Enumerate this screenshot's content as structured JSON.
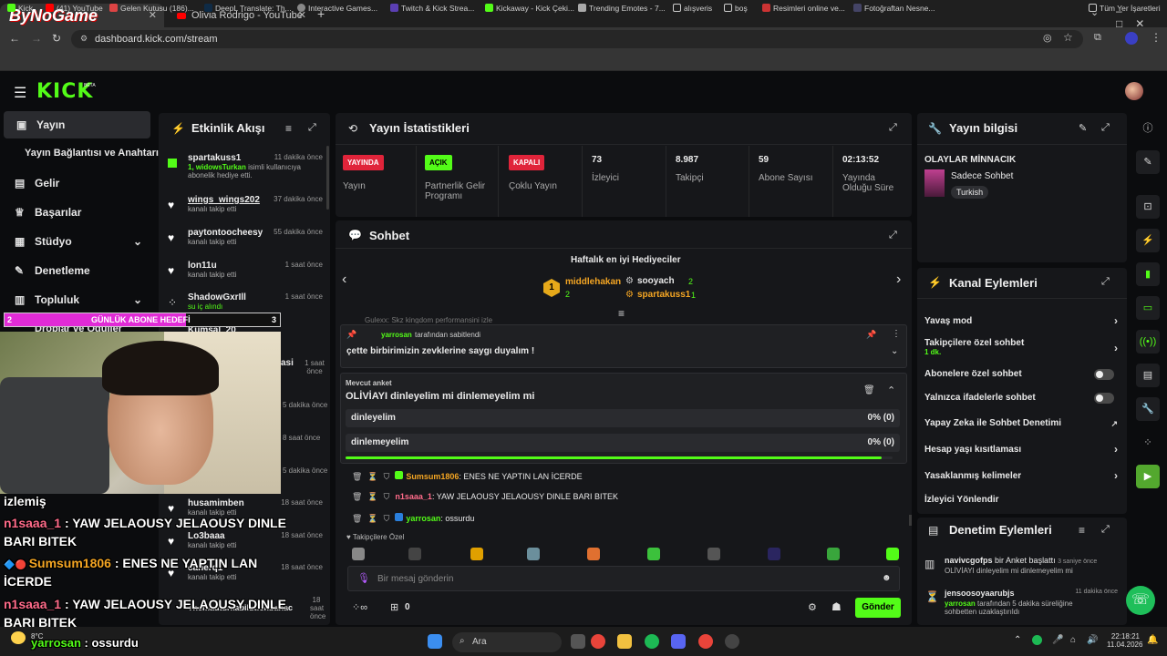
{
  "browser": {
    "tab1_title": "ByNoGame",
    "tab2_title": "Olivia Rodrigo - YouTube",
    "url": "dashboard.kick.com/stream",
    "bookmarks": [
      "Kick",
      "(41) YouTube",
      "Gelen Kutusu (186)...",
      "DeepL Translate: Th...",
      "Interactive Games...",
      "Twitch & Kick Strea...",
      "Kickaway - Kick Çeki...",
      "Trending Emotes - 7...",
      "alışveris",
      "boş",
      "Resimleri online ve...",
      "Fotoğraftan Nesne..."
    ],
    "bookmarks_right": "Tüm Yer İşaretleri"
  },
  "kick": {
    "logo": "KICK",
    "beta": "BETA"
  },
  "sidebar": {
    "items": [
      "Yayın",
      "Yayın Bağlantısı ve Anahtarı",
      "Gelir",
      "Başarılar",
      "Stüdyo",
      "Denetleme",
      "Topluluk",
      "Droplar ve Ödüller"
    ]
  },
  "activity": {
    "title": "Etkinlik Akışı",
    "items": [
      {
        "name": "spartakuss1",
        "time": "11 dakika önce",
        "text1": "1, widowsTurkan",
        "text2": "isimli kullanıcıya abonelik hediye etti."
      },
      {
        "name": "wings_wings202",
        "time": "37 dakika önce",
        "text": "kanalı takip etti"
      },
      {
        "name": "paytontoocheesy",
        "time": "55 dakika önce",
        "text": "kanalı takip etti"
      },
      {
        "name": "lon11u",
        "time": "1 saat önce",
        "text": "kanalı takip etti"
      },
      {
        "name": "ShadowGxrIll",
        "time": "1 saat önce",
        "text": "su iç alındı"
      },
      {
        "name": "Kumsal_20",
        "time": "",
        "text": ""
      },
      {
        "name": "husamimben",
        "time": "18 saat önce",
        "text": "kanalı takip etti"
      },
      {
        "name": "Lo3baaa",
        "time": "18 saat önce",
        "text": "kanalı takip etti"
      },
      {
        "name": "canerq1",
        "time": "18 saat önce",
        "text": "kanalı takip etti"
      },
      {
        "name": "Themadturkabilutfenbanac",
        "time": "18 saat önce",
        "text": ""
      }
    ],
    "partial_times": [
      "1 saat önce",
      "5 dakika önce",
      "8 saat önce",
      "5 dakika önce",
      "8 saat önce"
    ],
    "partial_name": "asi"
  },
  "stats": {
    "title": "Yayın İstatistikleri",
    "items": [
      {
        "badge": "YAYINDA",
        "label": "Yayın",
        "color": "#e0243a"
      },
      {
        "badge": "AÇIK",
        "label": "Partnerlik Gelir Programı",
        "color": "#53fc18"
      },
      {
        "badge": "KAPALI",
        "label": "Çoklu Yayın",
        "color": "#e0243a"
      },
      {
        "value": "73",
        "label": "İzleyici"
      },
      {
        "value": "8.987",
        "label": "Takipçi"
      },
      {
        "value": "59",
        "label": "Abone Sayısı"
      },
      {
        "value": "02:13:52",
        "label": "Yayında Olduğu Süre"
      }
    ]
  },
  "chat": {
    "title": "Sohbet",
    "gifters_title": "Haftalık en iyi Hediyeciler",
    "gifters": [
      {
        "name": "middlehakan",
        "count": "2"
      },
      {
        "name": "sooyach",
        "count": "2"
      },
      {
        "name": "spartakuss1",
        "count": "1"
      }
    ],
    "rank": "1",
    "partial_msg": "Gulexx: Skz kingdom performansini izle",
    "pinned_by": "yarrosan",
    "pinned_suffix": "tarafından sabitlendi",
    "pinned_text": "çette birbirimizin zevklerine saygı duyalım !",
    "poll_label": "Mevcut anket",
    "poll_question": "OLİVİAYI dinleyelim mi dinlemeyelim mi",
    "poll_options": [
      {
        "label": "dinleyelim",
        "result": "0% (0)"
      },
      {
        "label": "dinlemeyelim",
        "result": "0% (0)"
      }
    ],
    "poll_remaining": 0.98,
    "messages": [
      {
        "user": "Sumsum1806",
        "color": "#f5a623",
        "text": ": ENES NE YAPTIN LAN İCERDE"
      },
      {
        "user": "n1saaa_1",
        "color": "#ff6b8a",
        "text": ": YAW JELAOUSY JELAOUSY DINLE BARI BITEK"
      },
      {
        "user": "yarrosan",
        "color": "#53fc18",
        "text": ": ossurdu"
      }
    ],
    "emote_section": "Takipçilere Özel",
    "input_placeholder": "Bir mesaj gönderin",
    "count": "0",
    "send": "Gönder"
  },
  "stream_info": {
    "title": "Yayın bilgisi",
    "stream_title": "OLAYLAR MİNNACIK",
    "category": "Sadece Sohbet",
    "tag": "Turkish"
  },
  "channel_actions": {
    "title": "Kanal Eylemleri",
    "items": [
      {
        "label": "Yavaş mod",
        "type": "chevron"
      },
      {
        "label": "Takipçilere özel sohbet",
        "sub": "1 dk.",
        "type": "chevron"
      },
      {
        "label": "Abonelere özel sohbet",
        "type": "toggle"
      },
      {
        "label": "Yalnızca ifadelerle sohbet",
        "type": "toggle"
      },
      {
        "label": "Yapay Zeka ile Sohbet Denetimi",
        "type": "link"
      },
      {
        "label": "Hesap yaşı kısıtlaması",
        "type": "chevron"
      },
      {
        "label": "Yasaklanmış kelimeler",
        "type": "chevron"
      },
      {
        "label": "İzleyici Yönlendir",
        "type": "none"
      }
    ]
  },
  "mod_actions": {
    "title": "Denetim Eylemleri",
    "items": [
      {
        "user": "navivcgofps",
        "action": "bir Anket başlattı",
        "time": "3 saniye önce",
        "detail": "OLİVİAYI dinleyelim mi dinlemeyelim mi"
      },
      {
        "user": "jensoosoyaarubjs",
        "action": "",
        "time": "11 dakika önce",
        "detail_user": "yarrosan",
        "detail": "tarafından 5 dakika süreliğine sohbetten uzaklaştırıldı"
      }
    ]
  },
  "overlay": {
    "sub_goal_start": "2",
    "sub_goal_label": "GÜNLÜK ABONE HEDEFİ",
    "sub_goal_end": "3",
    "sub_goal_progress": 0.66,
    "chat_lines": [
      {
        "text": "izlemiş"
      },
      {
        "user": "n1saaa_1",
        "text": " : YAW JELAOUSY JELAOUSY DINLE"
      },
      {
        "text": "BARI BITEK"
      },
      {
        "user": "Sumsum1806",
        "text": " : ENES NE YAPTIN LAN"
      },
      {
        "text": "İCERDE"
      },
      {
        "user": "n1saaa_1",
        "text": " : YAW JELAOUSY JELAOUSY DINLE"
      },
      {
        "text": "BARI BITEK"
      },
      {
        "user": "yarrosan",
        "text": " : ossurdu"
      }
    ],
    "temp": "8°C"
  },
  "taskbar": {
    "search": "Ara",
    "time": "22:18:21",
    "date": "11.04.2026"
  }
}
